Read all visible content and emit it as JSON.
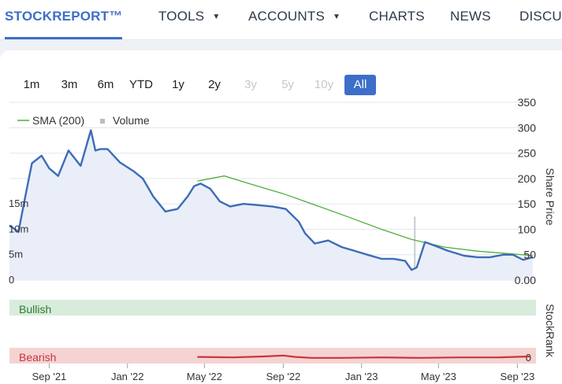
{
  "nav": {
    "items": [
      {
        "label": "STOCKREPORT™",
        "caret": false,
        "active": true
      },
      {
        "label": "TOOLS",
        "caret": true,
        "active": false
      },
      {
        "label": "ACCOUNTS",
        "caret": true,
        "active": false
      },
      {
        "label": "CHARTS",
        "caret": false,
        "active": false
      },
      {
        "label": "NEWS",
        "caret": false,
        "active": false
      },
      {
        "label": "DISCUSS",
        "caret": false,
        "active": false
      }
    ]
  },
  "range": {
    "buttons": [
      {
        "label": "1m",
        "state": "normal"
      },
      {
        "label": "3m",
        "state": "normal"
      },
      {
        "label": "6m",
        "state": "normal"
      },
      {
        "label": "YTD",
        "state": "normal"
      },
      {
        "label": "1y",
        "state": "normal"
      },
      {
        "label": "2y",
        "state": "normal"
      },
      {
        "label": "3y",
        "state": "disabled"
      },
      {
        "label": "5y",
        "state": "disabled"
      },
      {
        "label": "10y",
        "state": "disabled"
      },
      {
        "label": "All",
        "state": "active"
      }
    ]
  },
  "chart_data": {
    "type": "line",
    "legend": {
      "sma_label": "SMA (200)",
      "volume_label": "Volume",
      "placement": "top-left"
    },
    "price_axis": {
      "title": "Share Price",
      "ticks": [
        "0.00",
        "50",
        "100",
        "150",
        "200",
        "250",
        "300",
        "350"
      ],
      "range": [
        0,
        350
      ]
    },
    "volume_axis": {
      "ticks": [
        "0",
        "5m",
        "10m",
        "15m"
      ]
    },
    "stockrank": {
      "axis_title": "StockRank",
      "bullish_label": "Bullish",
      "bearish_label": "Bearish",
      "value_label": "0"
    },
    "x_ticks": [
      "Sep '21",
      "Jan '22",
      "May '22",
      "Sep '22",
      "Jan '23",
      "May '23",
      "Sep '23"
    ],
    "colors": {
      "price": "#3d6cb8",
      "sma": "#4caf3a",
      "volume": "#c8ccd2",
      "bullish": "#d8ecdb",
      "bearish": "#f5d3d3",
      "rank": "#c8353c",
      "accent": "#3d6ec9"
    },
    "series": [
      {
        "name": "Price",
        "x": [
          "2021-07-01",
          "2021-07-15",
          "2021-07-25",
          "2021-08-05",
          "2021-08-20",
          "2021-09-01",
          "2021-09-15",
          "2021-10-01",
          "2021-10-20",
          "2021-11-05",
          "2021-11-12",
          "2021-11-20",
          "2021-12-01",
          "2021-12-20",
          "2022-01-10",
          "2022-01-25",
          "2022-02-10",
          "2022-03-01",
          "2022-03-20",
          "2022-04-05",
          "2022-04-15",
          "2022-04-25",
          "2022-05-10",
          "2022-05-25",
          "2022-06-10",
          "2022-07-01",
          "2022-07-20",
          "2022-08-15",
          "2022-09-05",
          "2022-09-25",
          "2022-10-05",
          "2022-10-20",
          "2022-11-10",
          "2022-12-01",
          "2022-12-20",
          "2023-01-10",
          "2023-02-01",
          "2023-02-20",
          "2023-03-10",
          "2023-03-20",
          "2023-03-28",
          "2023-04-10",
          "2023-04-25",
          "2023-05-15",
          "2023-06-10",
          "2023-07-01",
          "2023-07-20",
          "2023-08-10",
          "2023-08-25",
          "2023-09-10",
          "2023-09-25"
        ],
        "values": [
          108,
          95,
          160,
          230,
          245,
          220,
          205,
          255,
          225,
          295,
          255,
          258,
          258,
          232,
          215,
          200,
          165,
          135,
          140,
          165,
          185,
          190,
          180,
          155,
          145,
          150,
          148,
          145,
          140,
          115,
          92,
          72,
          78,
          65,
          58,
          50,
          42,
          42,
          38,
          20,
          25,
          75,
          68,
          58,
          48,
          45,
          45,
          50,
          50,
          40,
          45
        ]
      },
      {
        "name": "SMA (200)",
        "x": [
          "2022-04-20",
          "2022-06-01",
          "2022-07-15",
          "2022-09-01",
          "2022-10-20",
          "2022-12-10",
          "2023-02-01",
          "2023-03-20",
          "2023-05-10",
          "2023-07-01",
          "2023-08-20",
          "2023-09-25"
        ],
        "values": [
          195,
          205,
          188,
          170,
          148,
          125,
          100,
          80,
          65,
          57,
          52,
          48
        ]
      }
    ],
    "volume_spikes": [
      {
        "x": "2022-12-25",
        "value": 2.3
      },
      {
        "x": "2023-01-10",
        "value": 3.5
      },
      {
        "x": "2023-01-20",
        "value": 1.5
      },
      {
        "x": "2023-02-15",
        "value": 1.0
      },
      {
        "x": "2023-03-25",
        "value": 12.5
      },
      {
        "x": "2023-04-02",
        "value": 2.0
      },
      {
        "x": "2023-04-10",
        "value": 3.0
      },
      {
        "x": "2023-04-20",
        "value": 1.6
      }
    ],
    "stockrank_series": {
      "x": [
        "2022-04-20",
        "2022-06-15",
        "2022-08-01",
        "2022-09-01",
        "2022-09-20",
        "2022-10-15",
        "2022-12-01",
        "2023-02-01",
        "2023-04-01",
        "2023-06-01",
        "2023-08-01",
        "2023-09-20"
      ],
      "values": [
        14,
        13,
        15,
        17,
        14,
        12,
        12,
        13,
        12,
        13,
        13,
        15
      ]
    }
  }
}
